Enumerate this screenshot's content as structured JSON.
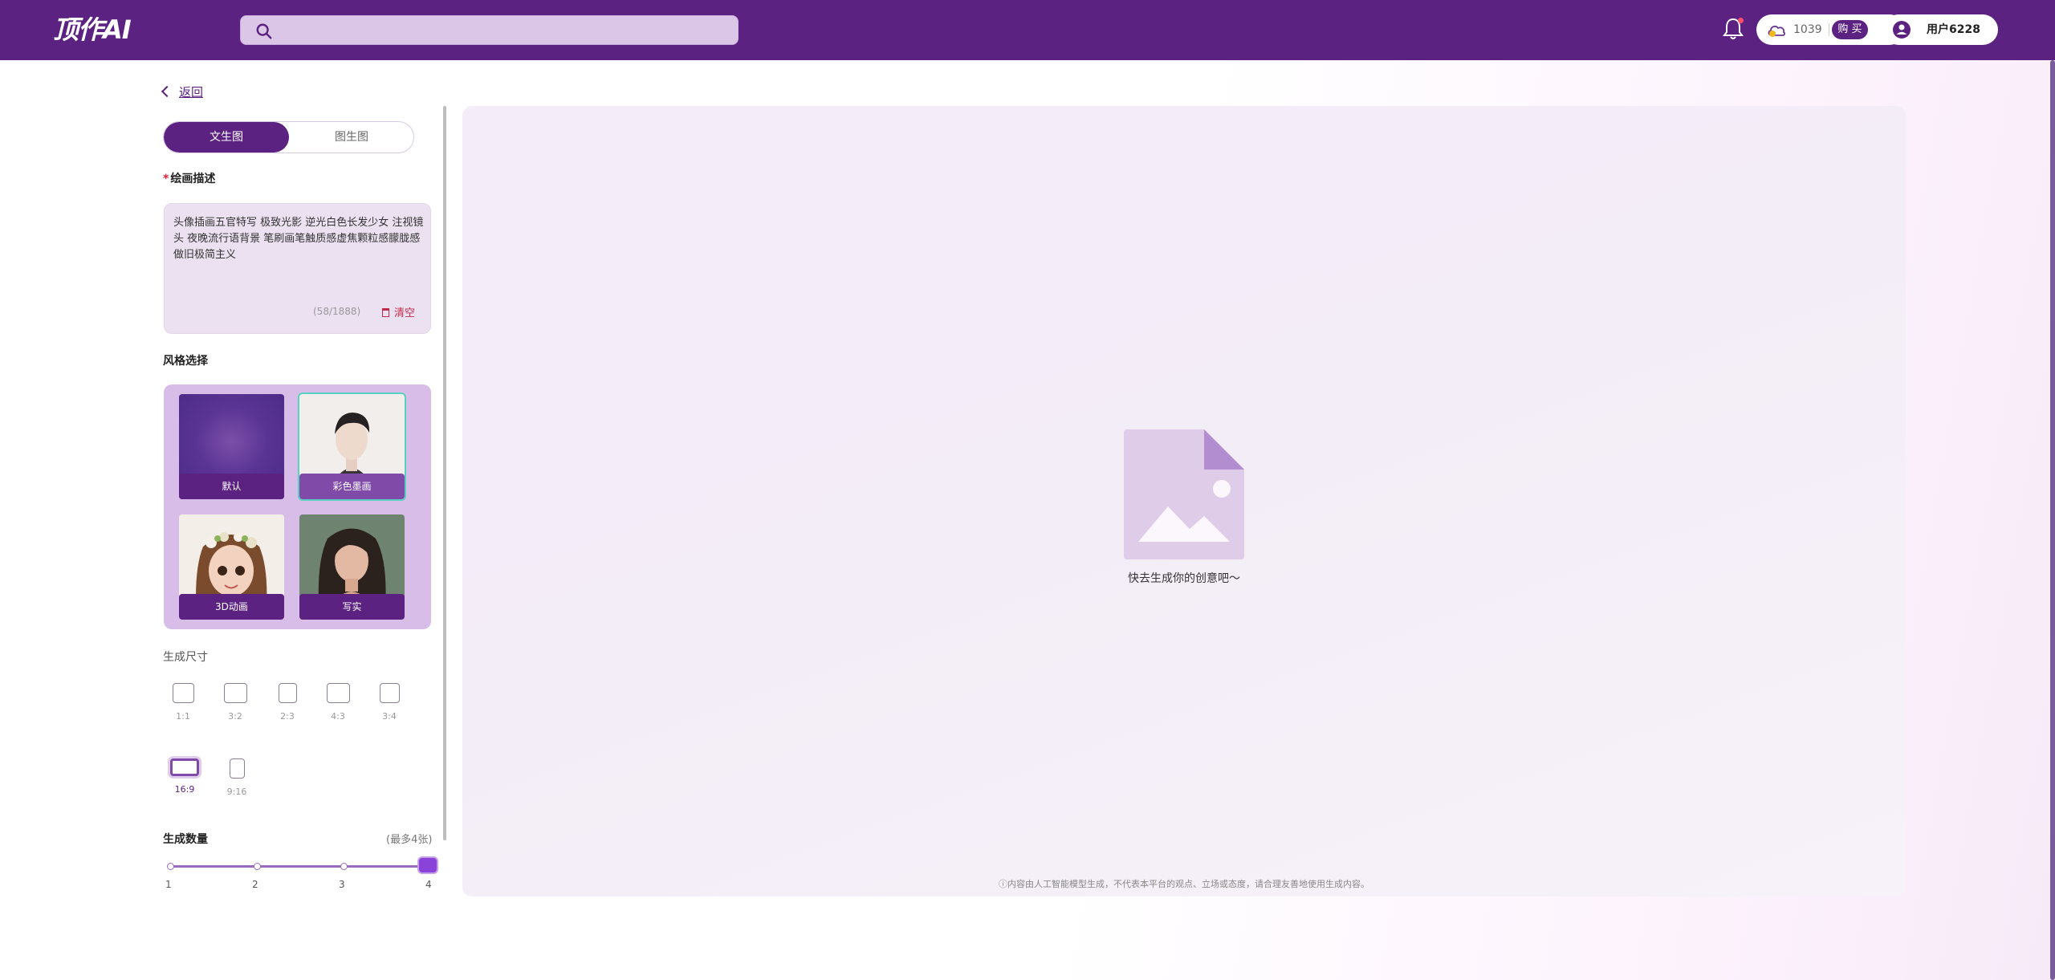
{
  "header": {
    "logo": "顶作AI",
    "search_placeholder": "",
    "points": "1039",
    "buy_label": "购 买",
    "username": "用户6228"
  },
  "sidebar": {
    "back_label": "返回",
    "tabs": [
      {
        "label": "文生图",
        "active": true
      },
      {
        "label": "图生图",
        "active": false
      }
    ],
    "prompt_label": "绘画描述",
    "prompt_text": "头像插画五官特写 极致光影 逆光白色长发少女 注视镜头 夜晚流行语背景 笔刷画笔触质感虚焦颗粒感朦胧感 做旧极简主义",
    "counter": "(58/1888)",
    "clear_label": "清空",
    "style_label": "风格选择",
    "styles": [
      {
        "label": "默认",
        "selected": false
      },
      {
        "label": "彩色墨画",
        "selected": true
      },
      {
        "label": "3D动画",
        "selected": false
      },
      {
        "label": "写实",
        "selected": false
      }
    ],
    "size_label": "生成尺寸",
    "ratios": [
      {
        "label": "1:1",
        "selected": false
      },
      {
        "label": "3:2",
        "selected": false
      },
      {
        "label": "2:3",
        "selected": false
      },
      {
        "label": "4:3",
        "selected": false
      },
      {
        "label": "3:4",
        "selected": false
      },
      {
        "label": "16:9",
        "selected": true
      },
      {
        "label": "9:16",
        "selected": false
      }
    ],
    "count_label": "生成数量",
    "count_max_note": "(最多4张)",
    "count_ticks": [
      "1",
      "2",
      "3",
      "4"
    ],
    "count_value": 4
  },
  "canvas": {
    "placeholder_text": "快去生成你的创意吧～",
    "disclaimer": "ⓘ内容由人工智能模型生成，不代表本平台的观点、立场或态度，请合理友善地使用生成内容。"
  },
  "colors": {
    "brand": "#5b2282",
    "accent_selected": "#59d1c2",
    "slider_thumb": "#8a43d9",
    "danger": "#c22a4a"
  }
}
